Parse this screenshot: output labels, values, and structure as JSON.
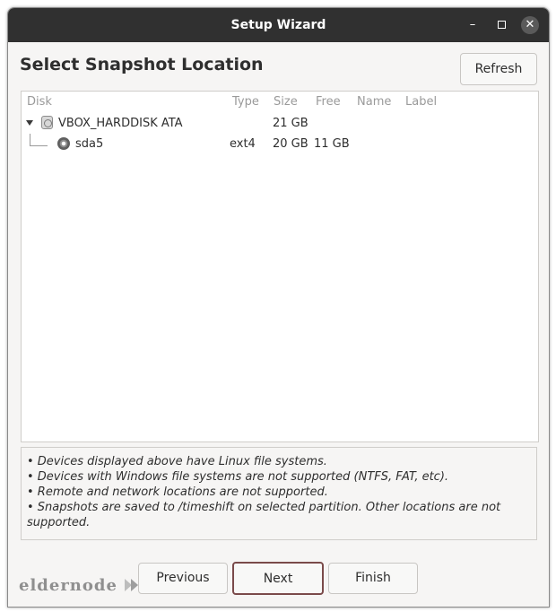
{
  "window": {
    "title": "Setup Wizard"
  },
  "page": {
    "heading": "Select Snapshot Location",
    "refresh_label": "Refresh"
  },
  "table": {
    "columns": [
      "Disk",
      "Type",
      "Size",
      "Free",
      "Name",
      "Label"
    ],
    "rows": [
      {
        "disk": "VBOX_HARDDISK ATA",
        "type": "",
        "size": "21 GB",
        "free": "",
        "name": "",
        "label": ""
      },
      {
        "disk": "sda5",
        "type": "ext4",
        "size": "20 GB",
        "free": "11 GB",
        "name": "",
        "label": ""
      }
    ]
  },
  "info_notes": [
    "• Devices displayed above have Linux file systems.",
    "• Devices with Windows file systems are not supported (NTFS, FAT, etc).",
    "• Remote and network locations are not supported.",
    "• Snapshots are saved to /timeshift on selected partition. Other locations are not supported."
  ],
  "footer": {
    "logo_text": "eldernode",
    "previous_label": "Previous",
    "next_label": "Next",
    "finish_label": "Finish"
  },
  "icons": {
    "minimize": "minimize-icon",
    "maximize": "maximize-icon",
    "close": "close-icon",
    "disk": "hard-disk-icon",
    "partition": "partition-icon",
    "expander": "expander-down-icon"
  },
  "colors": {
    "titlebar": "#303030",
    "next_border": "#7a4a4a"
  }
}
